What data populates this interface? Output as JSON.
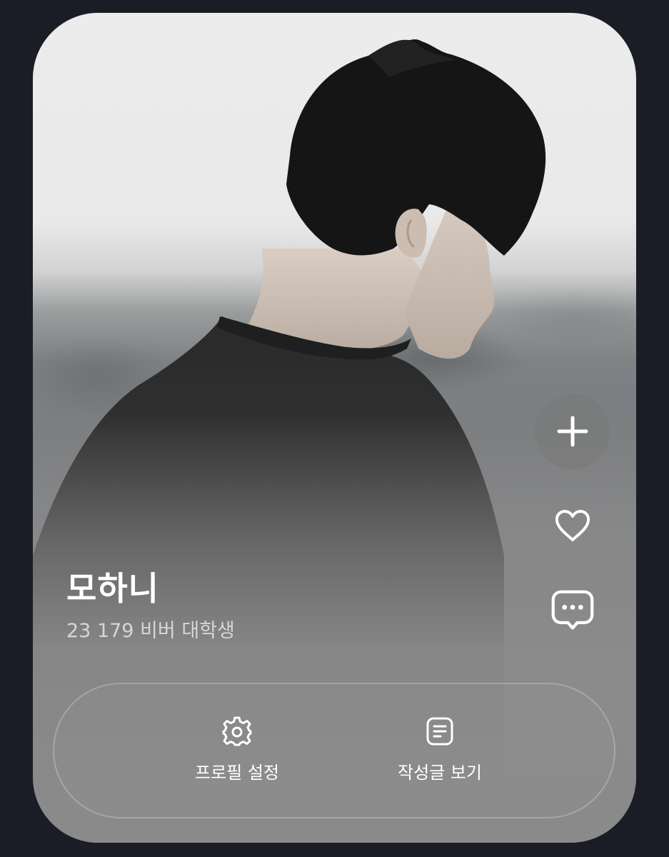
{
  "profile": {
    "name": "모하니",
    "subtitle": "23 179 비버 대학생",
    "photo": "young man with black hair in black t-shirt looking down, blurred outdoor background"
  },
  "side_actions": [
    {
      "icon": "plus-icon"
    },
    {
      "icon": "heart-icon"
    },
    {
      "icon": "chat-bubble-icon"
    }
  ],
  "bottom_bar": {
    "items": [
      {
        "label": "프로필 설정",
        "icon": "gear-icon"
      },
      {
        "label": "작성글 보기",
        "icon": "document-icon"
      }
    ]
  },
  "colors": {
    "page_background": "#1b1d26",
    "text_primary": "#ffffff",
    "text_secondary": "#d6d6d6"
  }
}
